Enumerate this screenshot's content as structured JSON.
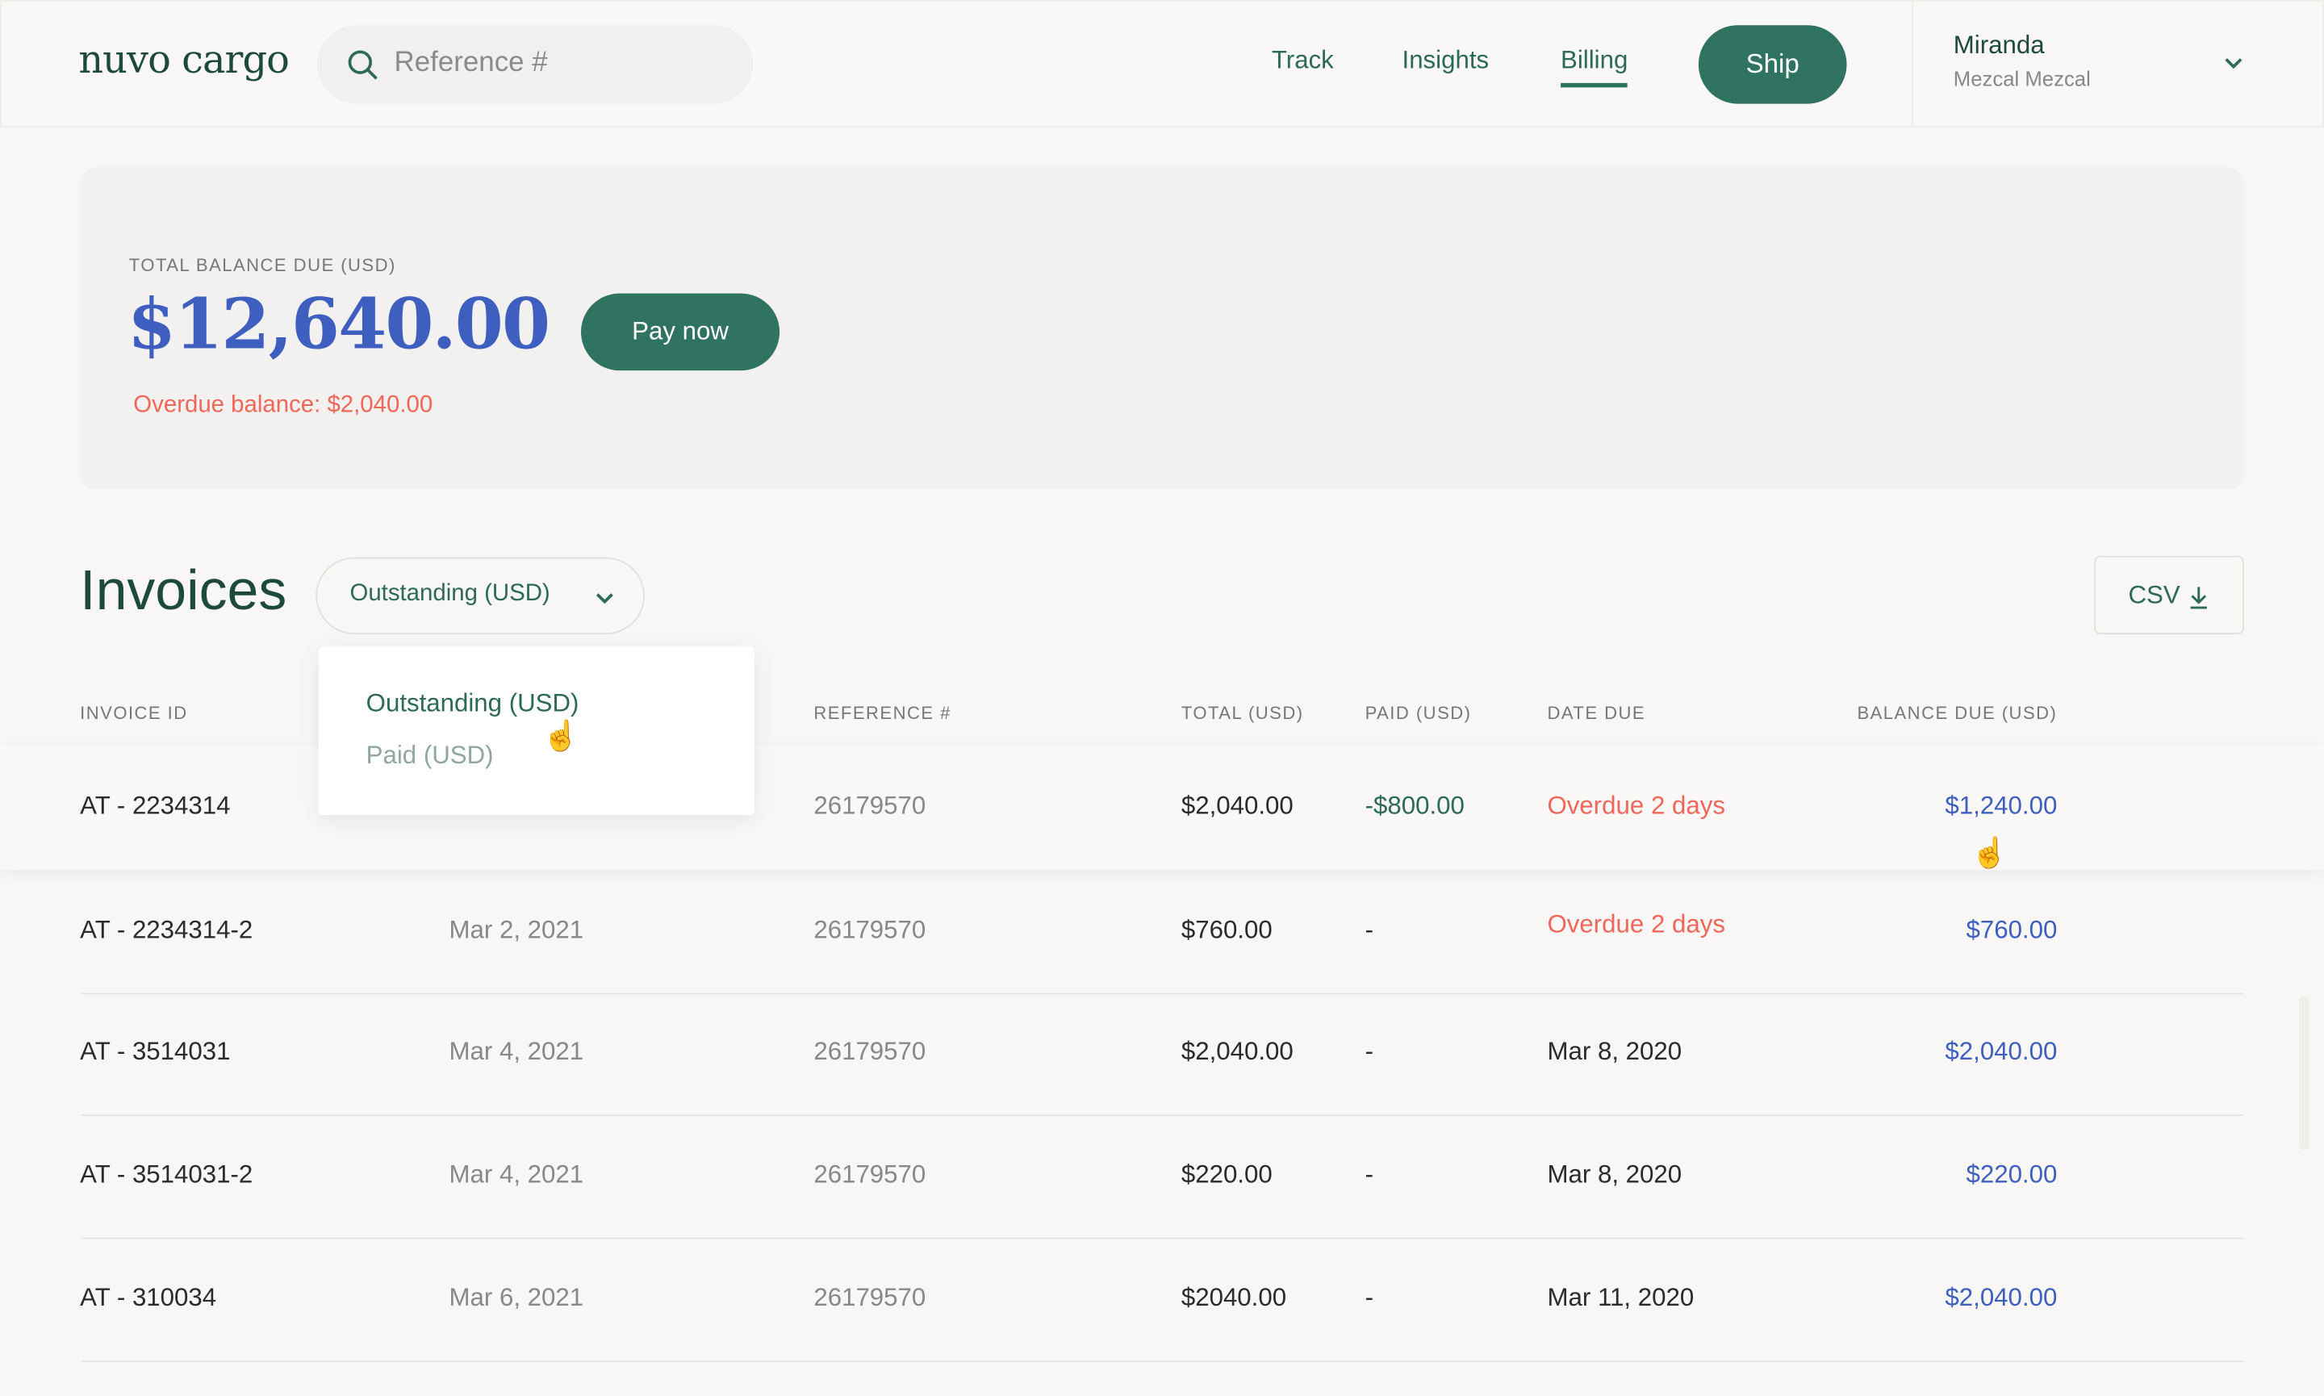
{
  "header": {
    "logo": "nuvo cargo",
    "search_placeholder": "Reference #",
    "nav": [
      {
        "label": "Track"
      },
      {
        "label": "Insights"
      },
      {
        "label": "Billing",
        "active": true
      }
    ],
    "ship_label": "Ship",
    "user": {
      "name": "Miranda",
      "company": "Mezcal Mezcal"
    }
  },
  "balance": {
    "label": "TOTAL BALANCE DUE (USD)",
    "amount": "$12,640.00",
    "pay_label": "Pay now",
    "overdue": "Overdue balance: $2,040.00"
  },
  "invoices": {
    "title": "Invoices",
    "filter": "Outstanding (USD)",
    "filter_options": [
      "Outstanding (USD)",
      "Paid (USD)"
    ],
    "csv_label": "CSV",
    "columns": [
      "INVOICE ID",
      "",
      "REFERENCE #",
      "TOTAL (USD)",
      "PAID (USD)",
      "DATE DUE",
      "BALANCE DUE (USD)"
    ],
    "rows": [
      {
        "id": "AT - 2234314",
        "date": "",
        "ref": "26179570",
        "total": "$2,040.00",
        "paid": "-$800.00",
        "due": "Overdue 2 days",
        "overdue": true,
        "balance": "$1,240.00"
      },
      {
        "id": "AT - 2234314-2",
        "date": "Mar 2, 2021",
        "ref": "26179570",
        "total": "$760.00",
        "paid": "-",
        "due": "Overdue 2 days",
        "overdue": true,
        "balance": "$760.00"
      },
      {
        "id": "AT - 3514031",
        "date": "Mar 4, 2021",
        "ref": "26179570",
        "total": "$2,040.00",
        "paid": "-",
        "due": "Mar 8, 2020",
        "overdue": false,
        "balance": "$2,040.00"
      },
      {
        "id": "AT - 3514031-2",
        "date": "Mar 4, 2021",
        "ref": "26179570",
        "total": "$220.00",
        "paid": "-",
        "due": "Mar 8, 2020",
        "overdue": false,
        "balance": "$220.00"
      },
      {
        "id": "AT - 310034",
        "date": "Mar 6, 2021",
        "ref": "26179570",
        "total": "$2040.00",
        "paid": "-",
        "due": "Mar 11, 2020",
        "overdue": false,
        "balance": "$2,040.00"
      }
    ]
  },
  "colors": {
    "brand": "#2f7360",
    "amount": "#3e5fbf",
    "overdue": "#f0675a",
    "paid": "#2d6a54"
  }
}
